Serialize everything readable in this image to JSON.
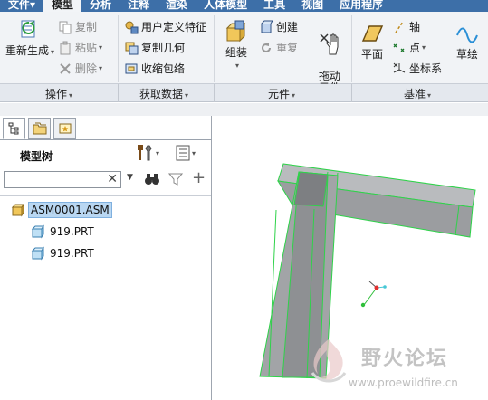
{
  "menu": {
    "tabs": [
      {
        "label": "文件▾"
      },
      {
        "label": "模型"
      },
      {
        "label": "分析"
      },
      {
        "label": "注释"
      },
      {
        "label": "渲染"
      },
      {
        "label": "人体模型"
      },
      {
        "label": "工具"
      },
      {
        "label": "视图"
      },
      {
        "label": "应用程序"
      }
    ],
    "active": "模型"
  },
  "ribbon": {
    "operations": {
      "regenerate": "重新生成",
      "copy": "复制",
      "paste": "粘贴",
      "delete": "删除",
      "group": "操作"
    },
    "get_data": {
      "udf": "用户定义特征",
      "copy_geom": "复制几何",
      "shrinkwrap": "收缩包络",
      "group": "获取数据"
    },
    "component": {
      "assemble": "组装",
      "create": "创建",
      "repeat": "重复",
      "drag": "拖动\n元件",
      "group": "元件"
    },
    "datum": {
      "plane": "平面",
      "axis": "轴",
      "point": "点",
      "csys": "坐标系",
      "sketch": "草绘",
      "group": "基准"
    }
  },
  "model_tree": {
    "title": "模型树",
    "search_placeholder": "",
    "items": [
      {
        "label": "ASM0001.ASM",
        "level": 0,
        "selected": true
      },
      {
        "label": "919.PRT",
        "level": 1
      },
      {
        "label": "919.PRT",
        "level": 1
      }
    ]
  },
  "watermark": {
    "title": "野火论坛",
    "url": "www.proewildfire.cn"
  },
  "colors": {
    "menubar": "#3d6fa8",
    "selection_edge": "#2fd24a",
    "part_fill": "#9b9da0"
  }
}
